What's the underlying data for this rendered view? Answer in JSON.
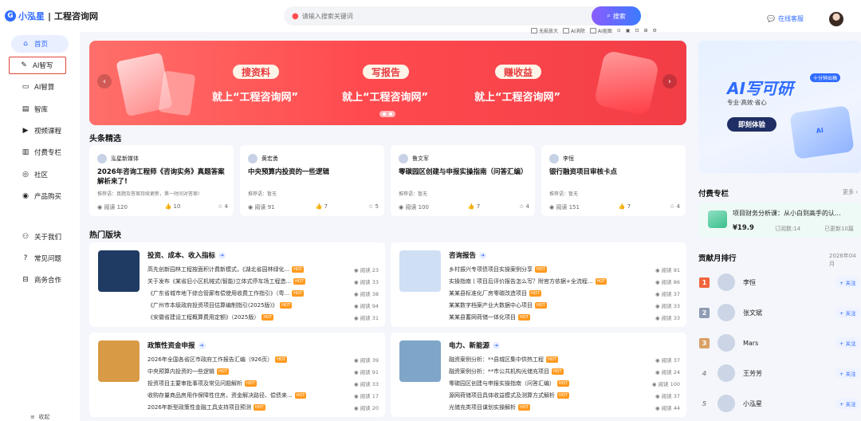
{
  "header": {
    "logo_text": "小泓星",
    "site_name": "工程咨询网",
    "search_placeholder": "请输入搜索关键词",
    "search_button": "搜索",
    "tools": [
      "无损放大",
      "AI消除",
      "AI抠图"
    ],
    "service_label": "在线客服"
  },
  "sidebar": {
    "items": [
      {
        "label": "首页",
        "icon": "home-icon"
      },
      {
        "label": "AI智写",
        "icon": "pen-icon"
      },
      {
        "label": "AI智算",
        "icon": "computer-icon"
      },
      {
        "label": "智库",
        "icon": "book-icon"
      },
      {
        "label": "视频课程",
        "icon": "play-icon"
      },
      {
        "label": "付费专栏",
        "icon": "document-icon"
      },
      {
        "label": "社区",
        "icon": "community-icon"
      },
      {
        "label": "产品购买",
        "icon": "cart-icon"
      }
    ],
    "bottom_items": [
      {
        "label": "关于我们",
        "icon": "people-icon"
      },
      {
        "label": "常见问题",
        "icon": "question-icon"
      },
      {
        "label": "商务合作",
        "icon": "handshake-icon"
      }
    ],
    "collapse_label": "收起"
  },
  "banner": {
    "pills": [
      "搜资料",
      "写报告",
      "赚收益"
    ],
    "slogans": [
      "就上“工程咨询网”",
      "就上“工程咨询网”",
      "就上“工程咨询网”"
    ]
  },
  "headlines": {
    "title": "头条精选",
    "cards": [
      {
        "author": "泓星新媒体",
        "title": "2026年咨询工程师《咨询实务》真题答案解析来了!",
        "rec": "推荐语：真题及答案持续更新，第一时间对答案!",
        "reads": "阅读 120",
        "likes": "10",
        "stars": "4"
      },
      {
        "author": "黄宏勇",
        "title": "中央预算内投资的一些逻辑",
        "rec": "推荐语：暂无",
        "reads": "阅读 91",
        "likes": "7",
        "stars": "5"
      },
      {
        "author": "鲁文军",
        "title": "零碳园区创建与申报实操指南（问答汇编）",
        "rec": "推荐语：暂无",
        "reads": "阅读 100",
        "likes": "7",
        "stars": "4"
      },
      {
        "author": "李恒",
        "title": "银行融资项目审核卡点",
        "rec": "推荐语：暂无",
        "reads": "阅读 151",
        "likes": "7",
        "stars": "4"
      }
    ]
  },
  "hot_boards": {
    "title": "热门版块",
    "boards": [
      {
        "name": "投资、成本、收入指标",
        "thumb_color": "#1f3b63",
        "rows": [
          {
            "text": "高先创新园林工程按面积计费新模式，《湖北省园林绿化...",
            "badge": "HOT",
            "reads": "阅读 23"
          },
          {
            "text": "关于发布《某省旧小区机械式(智能)立体式停车场工程造...",
            "badge": "HOT",
            "reads": "阅读 33"
          },
          {
            "text": "《广东省城市地下综合管廊有偿使用收费工作指引》（粤...",
            "badge": "HOT",
            "reads": "阅读 38"
          },
          {
            "text": "《广州市本级政府投资项目估算编制指引(2025版)》",
            "badge": "HOT",
            "reads": "阅读 94"
          },
          {
            "text": "《安徽省建设工程概算费用定额》（2025版）",
            "badge": "HOT",
            "reads": "阅读 31"
          }
        ]
      },
      {
        "name": "咨询报告",
        "thumb_color": "#cfe0f5",
        "rows": [
          {
            "text": "乡村振兴专项债项目实操案例分享",
            "badge": "HOT",
            "reads": "阅读 91"
          },
          {
            "text": "实操指南丨项目后评价报告怎么写？附官方依据+全流程...",
            "badge": "HOT",
            "reads": "阅读 86"
          },
          {
            "text": "某某县标准化厂房零碳改造项目",
            "badge": "HOT",
            "reads": "阅读 37"
          },
          {
            "text": "某某数字档案产业大数据中心项目",
            "badge": "HOT",
            "reads": "阅读 33"
          },
          {
            "text": "某某县蓄网荷储一体化项目",
            "badge": "HOT",
            "reads": "阅读 33"
          }
        ]
      },
      {
        "name": "政策性资金申报",
        "thumb_color": "#d89a45",
        "rows": [
          {
            "text": "2026年全国各省区市政府工作报告汇编（926页）",
            "badge": "HOT",
            "reads": "阅读 39"
          },
          {
            "text": "中央预算内投资的一些逻辑",
            "badge": "HOT",
            "reads": "阅读 91"
          },
          {
            "text": "投资项目主要审批事项及常见问题解析",
            "badge": "HOT",
            "reads": "阅读 33"
          },
          {
            "text": "收购存量商品房用作保障性住房，资金解决路径、偿债来...",
            "badge": "HOT",
            "reads": "阅读 17"
          },
          {
            "text": "2026年新型政策性金融工具支持项目预测",
            "badge": "HOT",
            "reads": "阅读 20"
          }
        ]
      },
      {
        "name": "电力、新能源",
        "thumb_color": "#7fa6c9",
        "rows": [
          {
            "text": "融资案例分析：**县城区集中供热工程",
            "badge": "HOT",
            "reads": "阅读 37"
          },
          {
            "text": "融资案例分析：**市公共机构光储充项目",
            "badge": "HOT",
            "reads": "阅读 24"
          },
          {
            "text": "零碳园区创建与申报实操指南（问答汇编）",
            "badge": "HOT",
            "reads": "阅读 100"
          },
          {
            "text": "源网荷储项目具体收益模式及测算方式解析",
            "badge": "HOT",
            "reads": "阅读 37"
          },
          {
            "text": "光储充类项目谋划实操解析",
            "badge": "HOT",
            "reads": "阅读 44"
          }
        ]
      }
    ]
  },
  "promo": {
    "title": "AI写可研",
    "tag": "十分钟出稿",
    "subtitle": "专业·高效·省心",
    "cta": "即刻体验",
    "robot_label": "AI"
  },
  "paid_column": {
    "title": "付费专栏",
    "more": "更多",
    "item": {
      "title": "项目财务分析课：从小白到高手的认...",
      "price": "¥19.9",
      "sold": "订阅数:14",
      "updated": "已更新10篇"
    }
  },
  "ranking": {
    "title": "贡献月排行",
    "date": "2026年04月",
    "follow_label": "+ 关注",
    "rows": [
      {
        "rank": "1",
        "name": "李恒",
        "rank_color": "#f0643c"
      },
      {
        "rank": "2",
        "name": "张文斌",
        "rank_color": "#8f9bb3"
      },
      {
        "rank": "3",
        "name": "Mars",
        "rank_color": "#d9a066"
      },
      {
        "rank": "4",
        "name": "王芳芳",
        "rank_color": "#999999"
      },
      {
        "rank": "5",
        "name": "小泓星",
        "rank_color": "#999999"
      }
    ]
  }
}
